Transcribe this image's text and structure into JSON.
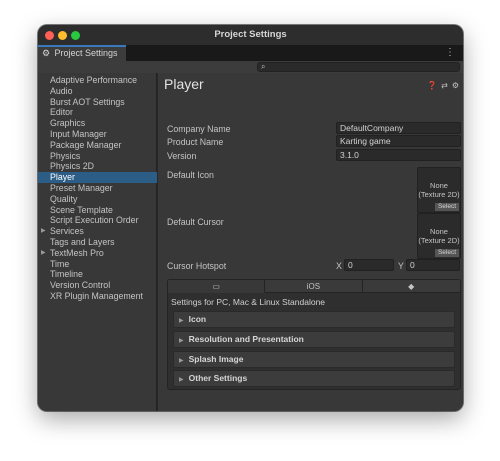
{
  "window": {
    "title": "Project Settings"
  },
  "tab": {
    "label": "Project Settings"
  },
  "kebab": "⋮",
  "sidebar": {
    "items": [
      {
        "label": "Adaptive Performance",
        "selected": false,
        "expandable": false
      },
      {
        "label": "Audio",
        "selected": false,
        "expandable": false
      },
      {
        "label": "Burst AOT Settings",
        "selected": false,
        "expandable": false
      },
      {
        "label": "Editor",
        "selected": false,
        "expandable": false
      },
      {
        "label": "Graphics",
        "selected": false,
        "expandable": false
      },
      {
        "label": "Input Manager",
        "selected": false,
        "expandable": false
      },
      {
        "label": "Package Manager",
        "selected": false,
        "expandable": false
      },
      {
        "label": "Physics",
        "selected": false,
        "expandable": false
      },
      {
        "label": "Physics 2D",
        "selected": false,
        "expandable": false
      },
      {
        "label": "Player",
        "selected": true,
        "expandable": false
      },
      {
        "label": "Preset Manager",
        "selected": false,
        "expandable": false
      },
      {
        "label": "Quality",
        "selected": false,
        "expandable": false
      },
      {
        "label": "Scene Template",
        "selected": false,
        "expandable": false
      },
      {
        "label": "Script Execution Order",
        "selected": false,
        "expandable": false
      },
      {
        "label": "Services",
        "selected": false,
        "expandable": true
      },
      {
        "label": "Tags and Layers",
        "selected": false,
        "expandable": false
      },
      {
        "label": "TextMesh Pro",
        "selected": false,
        "expandable": true
      },
      {
        "label": "Time",
        "selected": false,
        "expandable": false
      },
      {
        "label": "Timeline",
        "selected": false,
        "expandable": false
      },
      {
        "label": "Version Control",
        "selected": false,
        "expandable": false
      },
      {
        "label": "XR Plugin Management",
        "selected": false,
        "expandable": false
      }
    ]
  },
  "player": {
    "title": "Player",
    "company_name_label": "Company Name",
    "company_name_value": "DefaultCompany",
    "product_name_label": "Product Name",
    "product_name_value": "Karting game",
    "version_label": "Version",
    "version_value": "3.1.0",
    "default_icon_label": "Default Icon",
    "default_icon_slot": "None\n(Texture 2D)",
    "default_cursor_label": "Default Cursor",
    "default_cursor_slot": "None\n(Texture 2D)",
    "select_label": "Select",
    "cursor_hotspot_label": "Cursor Hotspot",
    "hotspot_x_label": "X",
    "hotspot_x_value": "0",
    "hotspot_y_label": "Y",
    "hotspot_y_value": "0"
  },
  "platform_tabs": [
    {
      "icon": "monitor-icon",
      "glyph": "▭",
      "active": true
    },
    {
      "label": "iOS",
      "active": false
    },
    {
      "icon": "android-icon",
      "glyph": "◆",
      "active": false
    }
  ],
  "settings_for": "Settings for PC, Mac & Linux Standalone",
  "sections": [
    {
      "label": "Icon"
    },
    {
      "label": "Resolution and Presentation"
    },
    {
      "label": "Splash Image"
    },
    {
      "label": "Other Settings"
    }
  ],
  "colors": {
    "selection": "#2c5d87",
    "accent": "#3a79bb"
  }
}
